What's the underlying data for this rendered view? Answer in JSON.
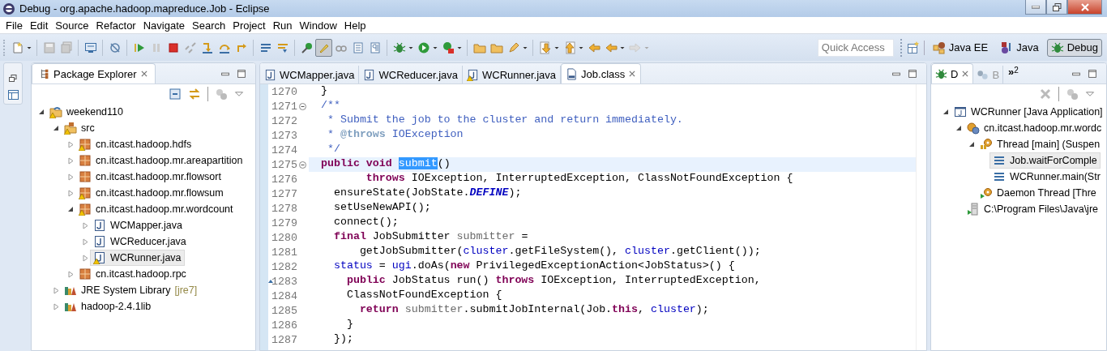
{
  "window": {
    "title": "Debug - org.apache.hadoop.mapreduce.Job - Eclipse"
  },
  "menu": [
    "File",
    "Edit",
    "Source",
    "Refactor",
    "Navigate",
    "Search",
    "Project",
    "Run",
    "Window",
    "Help"
  ],
  "toolbar_buttons": [
    {
      "selected": false
    },
    {
      "selected": false
    },
    {
      "selected": false
    },
    {
      "selected": false
    },
    {
      "selected": false
    },
    {
      "selected": false
    },
    {
      "selected": false
    },
    {
      "selected": false
    },
    {
      "selected": false
    },
    {
      "selected": false
    },
    {
      "selected": false
    },
    {
      "selected": false
    },
    {
      "selected": false
    },
    {
      "selected": false
    },
    {
      "selected": false
    },
    {
      "selected": true
    },
    {
      "selected": false
    },
    {
      "selected": false
    },
    {
      "selected": false
    },
    {
      "selected": false
    },
    {
      "selected": false
    },
    {
      "selected": false
    },
    {
      "selected": false
    },
    {
      "selected": false
    },
    {
      "selected": false
    },
    {
      "selected": false
    },
    {
      "selected": false
    },
    {
      "selected": false
    },
    {
      "selected": false
    },
    {
      "selected": false
    }
  ],
  "quick_access": {
    "placeholder": "Quick Access"
  },
  "perspectives": [
    {
      "label": "Java EE",
      "selected": false
    },
    {
      "label": "Java",
      "selected": false
    },
    {
      "label": "Debug",
      "selected": true
    }
  ],
  "package_explorer": {
    "tab": {
      "label": "Package Explorer",
      "selected": true
    },
    "tree": [
      {
        "label": "weekend110",
        "kind": "project",
        "expanded": true,
        "warning": true,
        "selected": false,
        "children": [
          {
            "label": "src",
            "kind": "folder",
            "expanded": true,
            "warning": true,
            "selected": false,
            "children": [
              {
                "label": "cn.itcast.hadoop.hdfs",
                "kind": "package",
                "expanded": false,
                "warning": true,
                "selected": false
              },
              {
                "label": "cn.itcast.hadoop.mr.areapartition",
                "kind": "package",
                "expanded": false,
                "warning": false,
                "selected": false
              },
              {
                "label": "cn.itcast.hadoop.mr.flowsort",
                "kind": "package",
                "expanded": false,
                "warning": false,
                "selected": false
              },
              {
                "label": "cn.itcast.hadoop.mr.flowsum",
                "kind": "package",
                "expanded": false,
                "warning": true,
                "selected": false
              },
              {
                "label": "cn.itcast.hadoop.mr.wordcount",
                "kind": "package",
                "expanded": true,
                "warning": true,
                "selected": false,
                "children": [
                  {
                    "label": "WCMapper.java",
                    "kind": "java",
                    "expanded": false,
                    "warning": false,
                    "selected": false
                  },
                  {
                    "label": "WCReducer.java",
                    "kind": "java",
                    "expanded": false,
                    "warning": false,
                    "selected": false
                  },
                  {
                    "label": "WCRunner.java",
                    "kind": "java",
                    "expanded": false,
                    "warning": true,
                    "selected": true
                  }
                ]
              },
              {
                "label": "cn.itcast.hadoop.rpc",
                "kind": "package",
                "expanded": false,
                "warning": false,
                "selected": false
              }
            ]
          },
          {
            "label": "JRE System Library",
            "decoration": "[jre7]",
            "kind": "library",
            "expanded": false,
            "warning": false,
            "selected": false
          },
          {
            "label": "hadoop-2.4.1lib",
            "kind": "library",
            "expanded": false,
            "warning": false,
            "selected": false
          }
        ]
      }
    ]
  },
  "editor": {
    "tabs": [
      {
        "label": "WCMapper.java",
        "kind": "java",
        "warning": false,
        "selected": false
      },
      {
        "label": "WCReducer.java",
        "kind": "java",
        "warning": false,
        "selected": false
      },
      {
        "label": "WCRunner.java",
        "kind": "java",
        "warning": true,
        "selected": false
      },
      {
        "label": "Job.class",
        "kind": "class",
        "warning": false,
        "selected": true
      }
    ],
    "lines": [
      {
        "number": "1270",
        "fold": false,
        "current": false,
        "override": false,
        "tokens": [
          {
            "text": "}",
            "kind": "plain"
          }
        ]
      },
      {
        "number": "1271",
        "fold": true,
        "current": false,
        "override": false,
        "tokens": [
          {
            "text": "/**",
            "kind": "comment"
          }
        ]
      },
      {
        "number": "1272",
        "fold": false,
        "current": false,
        "override": false,
        "tokens": [
          {
            "text": " * Submit the job to the cluster and return immediately.",
            "kind": "comment"
          }
        ]
      },
      {
        "number": "1273",
        "fold": false,
        "current": false,
        "override": false,
        "tokens": [
          {
            "text": " *",
            "kind": "comment"
          },
          {
            "text": " @throws",
            "kind": "doctag"
          },
          {
            "text": " IOException",
            "kind": "comment"
          }
        ]
      },
      {
        "number": "1274",
        "fold": false,
        "current": false,
        "override": false,
        "tokens": [
          {
            "text": " */",
            "kind": "comment"
          }
        ]
      },
      {
        "number": "1275",
        "fold": true,
        "current": true,
        "override": false,
        "tokens": [
          {
            "text": "public void ",
            "kind": "keyword"
          },
          {
            "text": "submit",
            "kind": "selected"
          },
          {
            "text": "()",
            "kind": "plain"
          }
        ]
      },
      {
        "number": "1276",
        "fold": false,
        "current": false,
        "override": false,
        "tokens": [
          {
            "text": "       throws",
            "kind": "keyword"
          },
          {
            "text": " IOException, InterruptedException, ClassNotFoundException {",
            "kind": "plain"
          }
        ]
      },
      {
        "number": "1277",
        "fold": false,
        "current": false,
        "override": false,
        "tokens": [
          {
            "text": "  ensureState(JobState.",
            "kind": "plain"
          },
          {
            "text": "DEFINE",
            "kind": "constant"
          },
          {
            "text": ");",
            "kind": "plain"
          }
        ]
      },
      {
        "number": "1278",
        "fold": false,
        "current": false,
        "override": false,
        "tokens": [
          {
            "text": "  setUseNewAPI();",
            "kind": "plain"
          }
        ]
      },
      {
        "number": "1279",
        "fold": false,
        "current": false,
        "override": false,
        "tokens": [
          {
            "text": "  connect();",
            "kind": "plain"
          }
        ]
      },
      {
        "number": "1280",
        "fold": false,
        "current": false,
        "override": false,
        "tokens": [
          {
            "text": "  final",
            "kind": "keyword"
          },
          {
            "text": " JobSubmitter ",
            "kind": "plain"
          },
          {
            "text": "submitter",
            "kind": "local"
          },
          {
            "text": " =",
            "kind": "plain"
          }
        ]
      },
      {
        "number": "1281",
        "fold": false,
        "current": false,
        "override": false,
        "tokens": [
          {
            "text": "      getJobSubmitter(",
            "kind": "plain"
          },
          {
            "text": "cluster",
            "kind": "field"
          },
          {
            "text": ".getFileSystem(), ",
            "kind": "plain"
          },
          {
            "text": "cluster",
            "kind": "field"
          },
          {
            "text": ".getClient());",
            "kind": "plain"
          }
        ]
      },
      {
        "number": "1282",
        "fold": false,
        "current": false,
        "override": false,
        "tokens": [
          {
            "text": "  status",
            "kind": "field"
          },
          {
            "text": " = ",
            "kind": "plain"
          },
          {
            "text": "ugi",
            "kind": "field"
          },
          {
            "text": ".doAs(",
            "kind": "plain"
          },
          {
            "text": "new",
            "kind": "keyword"
          },
          {
            "text": " PrivilegedExceptionAction<JobStatus>() {",
            "kind": "plain"
          }
        ]
      },
      {
        "number": "1283",
        "fold": false,
        "current": false,
        "override": true,
        "tokens": [
          {
            "text": "    public",
            "kind": "keyword"
          },
          {
            "text": " JobStatus run() ",
            "kind": "plain"
          },
          {
            "text": "throws",
            "kind": "keyword"
          },
          {
            "text": " IOException, InterruptedException,",
            "kind": "plain"
          }
        ]
      },
      {
        "number": "1284",
        "fold": false,
        "current": false,
        "override": false,
        "tokens": [
          {
            "text": "    ClassNotFoundException {",
            "kind": "plain"
          }
        ]
      },
      {
        "number": "1285",
        "fold": false,
        "current": false,
        "override": false,
        "tokens": [
          {
            "text": "      return ",
            "kind": "keyword"
          },
          {
            "text": "submitter",
            "kind": "local"
          },
          {
            "text": ".submitJobInternal(Job.",
            "kind": "plain"
          },
          {
            "text": "this",
            "kind": "keyword"
          },
          {
            "text": ", ",
            "kind": "plain"
          },
          {
            "text": "cluster",
            "kind": "field"
          },
          {
            "text": ");",
            "kind": "plain"
          }
        ]
      },
      {
        "number": "1286",
        "fold": false,
        "current": false,
        "override": false,
        "tokens": [
          {
            "text": "    }",
            "kind": "plain"
          }
        ]
      },
      {
        "number": "1287",
        "fold": false,
        "current": false,
        "override": false,
        "tokens": [
          {
            "text": "  });",
            "kind": "plain"
          }
        ]
      }
    ]
  },
  "debug_view": {
    "tabs": [
      {
        "label": "D",
        "kind": "debug",
        "selected": true
      },
      {
        "label": "B",
        "kind": "breakpoints",
        "selected": false
      }
    ],
    "overflow": {
      "label": "»",
      "count": "2"
    },
    "tree": [
      {
        "label": "WCRunner [Java Application]",
        "kind": "launch",
        "expanded": true,
        "selected": false,
        "children": [
          {
            "label": "cn.itcast.hadoop.mr.wordc",
            "kind": "process",
            "expanded": true,
            "selected": false,
            "children": [
              {
                "label": "Thread [main] (Suspen",
                "kind": "thread",
                "expanded": true,
                "selected": false,
                "children": [
                  {
                    "label": "Job.waitForComple",
                    "kind": "frame",
                    "selected": true
                  },
                  {
                    "label": "WCRunner.main(Str",
                    "kind": "frame",
                    "selected": false
                  }
                ]
              },
              {
                "label": "Daemon Thread [Thre",
                "kind": "daemon",
                "selected": false
              }
            ]
          },
          {
            "label": "C:\\Program Files\\Java\\jre",
            "kind": "jre",
            "selected": false
          }
        ]
      }
    ]
  }
}
